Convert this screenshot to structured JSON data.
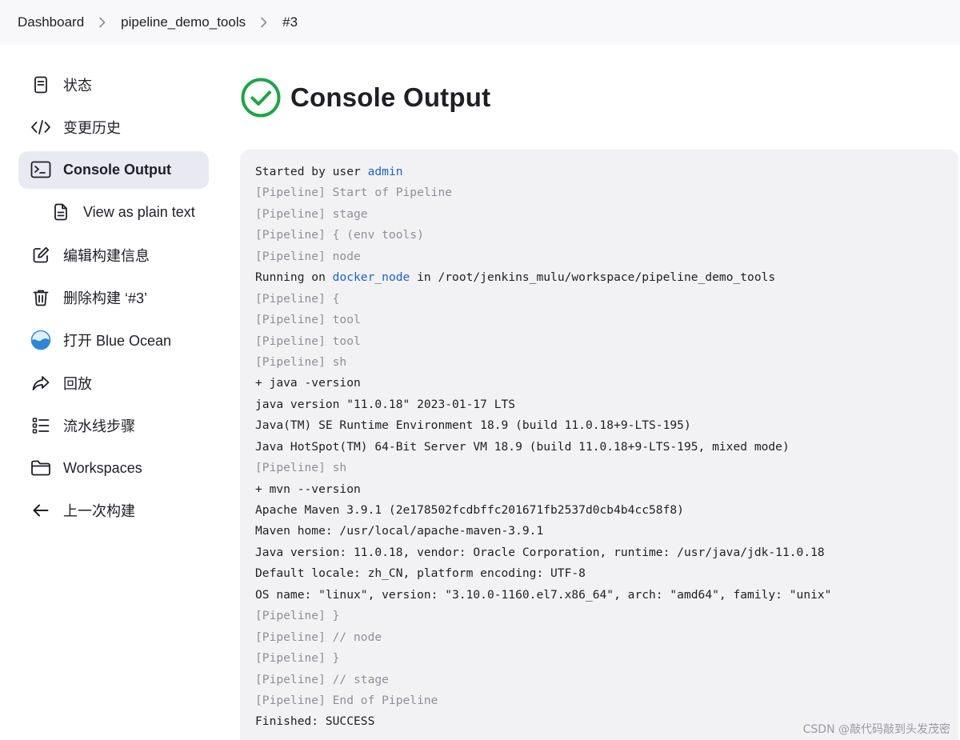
{
  "breadcrumb": {
    "items": [
      "Dashboard",
      "pipeline_demo_tools",
      "#3"
    ]
  },
  "sidebar": {
    "items": [
      {
        "label": "状态",
        "icon": "document-icon"
      },
      {
        "label": "变更历史",
        "icon": "code-icon"
      },
      {
        "label": "Console Output",
        "icon": "terminal-icon",
        "active": true
      },
      {
        "label": "View as plain text",
        "icon": "file-icon",
        "sub": true
      },
      {
        "label": "编辑构建信息",
        "icon": "edit-icon"
      },
      {
        "label": "删除构建 ‘#3’",
        "icon": "trash-icon"
      },
      {
        "label": "打开 Blue Ocean",
        "icon": "blue-ocean-icon"
      },
      {
        "label": "回放",
        "icon": "replay-icon"
      },
      {
        "label": "流水线步骤",
        "icon": "steps-icon"
      },
      {
        "label": "Workspaces",
        "icon": "folder-icon"
      },
      {
        "label": "上一次构建",
        "icon": "arrow-left-icon"
      }
    ]
  },
  "main": {
    "title": "Console Output",
    "status_icon": "success-check-icon",
    "status_color": "#1ea446"
  },
  "console": {
    "lines": [
      {
        "parts": [
          {
            "text": "Started by user "
          },
          {
            "text": "admin",
            "link": true
          }
        ]
      },
      {
        "text": "[Pipeline] Start of Pipeline",
        "dim": true
      },
      {
        "text": "[Pipeline] stage",
        "dim": true
      },
      {
        "text": "[Pipeline] { (env tools)",
        "dim": true
      },
      {
        "text": "[Pipeline] node",
        "dim": true
      },
      {
        "parts": [
          {
            "text": "Running on "
          },
          {
            "text": "docker_node",
            "link": true
          },
          {
            "text": " in /root/jenkins_mulu/workspace/pipeline_demo_tools"
          }
        ]
      },
      {
        "text": "[Pipeline] {",
        "dim": true
      },
      {
        "text": "[Pipeline] tool",
        "dim": true
      },
      {
        "text": "[Pipeline] tool",
        "dim": true
      },
      {
        "text": "[Pipeline] sh",
        "dim": true
      },
      {
        "text": "+ java -version"
      },
      {
        "text": "java version \"11.0.18\" 2023-01-17 LTS"
      },
      {
        "text": "Java(TM) SE Runtime Environment 18.9 (build 11.0.18+9-LTS-195)"
      },
      {
        "text": "Java HotSpot(TM) 64-Bit Server VM 18.9 (build 11.0.18+9-LTS-195, mixed mode)"
      },
      {
        "text": "[Pipeline] sh",
        "dim": true
      },
      {
        "text": "+ mvn --version"
      },
      {
        "text": "Apache Maven 3.9.1 (2e178502fcdbffc201671fb2537d0cb4b4cc58f8)"
      },
      {
        "text": "Maven home: /usr/local/apache-maven-3.9.1"
      },
      {
        "text": "Java version: 11.0.18, vendor: Oracle Corporation, runtime: /usr/java/jdk-11.0.18"
      },
      {
        "text": "Default locale: zh_CN, platform encoding: UTF-8"
      },
      {
        "text": "OS name: \"linux\", version: \"3.10.0-1160.el7.x86_64\", arch: \"amd64\", family: \"unix\""
      },
      {
        "text": "[Pipeline] }",
        "dim": true
      },
      {
        "text": "[Pipeline] // node",
        "dim": true
      },
      {
        "text": "[Pipeline] }",
        "dim": true
      },
      {
        "text": "[Pipeline] // stage",
        "dim": true
      },
      {
        "text": "[Pipeline] End of Pipeline",
        "dim": true
      },
      {
        "text": "Finished: SUCCESS"
      }
    ]
  },
  "watermark": "CSDN @敲代码敲到头发茂密",
  "colors": {
    "link": "#1f62c9",
    "dim_text": "#8f8f96",
    "console_bg": "#f2f2f4",
    "active_bg": "#e9eaf1",
    "success": "#1ea446"
  }
}
